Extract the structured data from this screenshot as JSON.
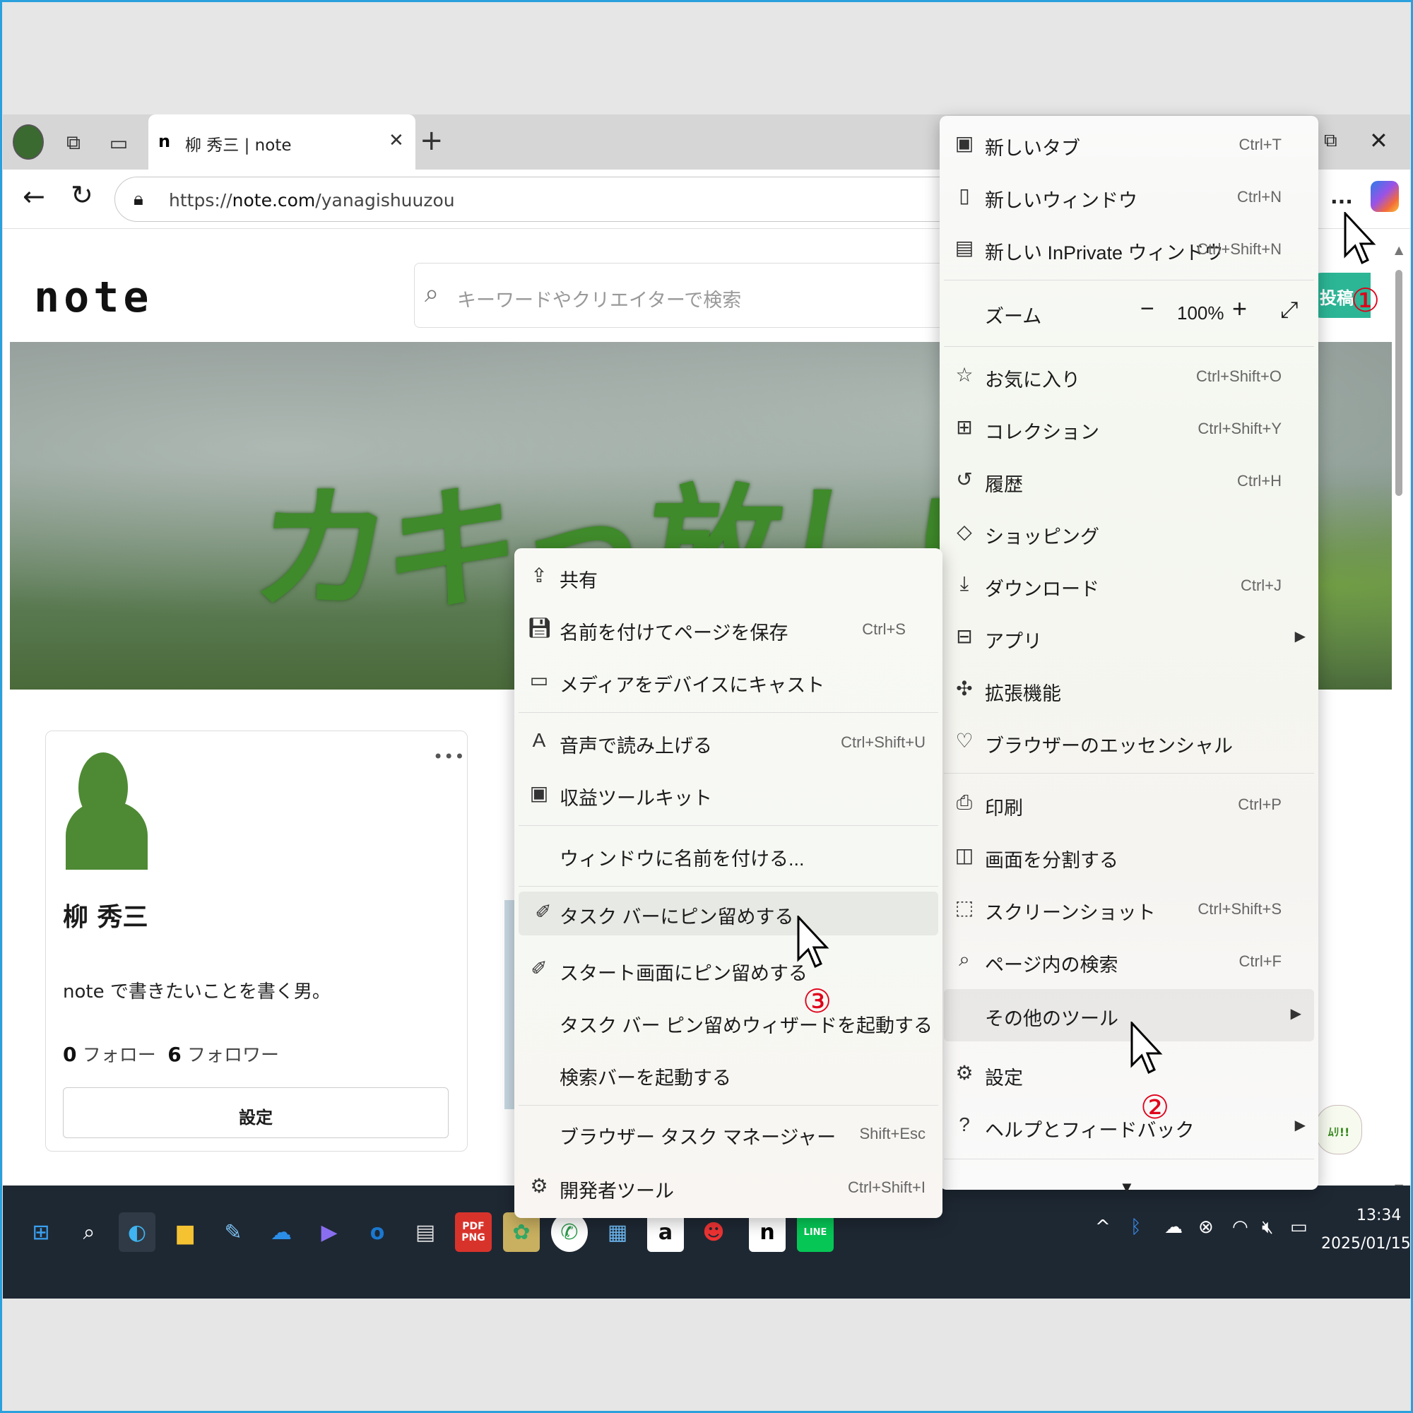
{
  "browser": {
    "tab_title": "柳 秀三 | note",
    "tab_favicon": "n",
    "url_prefix": "https://",
    "url_domain": "note.com",
    "url_path": "/yanagishuuzou",
    "more_label": "...",
    "icons": {
      "back": "back-arrow-icon",
      "refresh": "refresh-icon",
      "lock": "lock-icon",
      "copilot": "copilot-icon"
    }
  },
  "page": {
    "logo": "note",
    "search_placeholder": "キーワードやクリエイターで検索",
    "post_button": "投稿",
    "hero_text": "カキっ放し!!",
    "card_more": "•••",
    "user_name": "柳 秀三",
    "bio": "note で書きたいことを書く男。",
    "follow_count": "0",
    "follow_label": "フォロー",
    "follower_count": "6",
    "follower_label": "フォロワー",
    "settings_button": "設定",
    "stamp_text": "ﾑﾘ!!"
  },
  "main_menu": {
    "items": [
      {
        "label": "新しいタブ",
        "shortcut": "Ctrl+T"
      },
      {
        "label": "新しいウィンドウ",
        "shortcut": "Ctrl+N"
      },
      {
        "label": "新しい InPrivate ウィンドウ",
        "shortcut": "Ctrl+Shift+N"
      },
      {
        "label": "お気に入り",
        "shortcut": "Ctrl+Shift+O"
      },
      {
        "label": "コレクション",
        "shortcut": "Ctrl+Shift+Y"
      },
      {
        "label": "履歴",
        "shortcut": "Ctrl+H"
      },
      {
        "label": "ショッピング",
        "shortcut": ""
      },
      {
        "label": "ダウンロード",
        "shortcut": "Ctrl+J"
      },
      {
        "label": "アプリ",
        "shortcut": ""
      },
      {
        "label": "拡張機能",
        "shortcut": ""
      },
      {
        "label": "ブラウザーのエッセンシャル",
        "shortcut": ""
      },
      {
        "label": "印刷",
        "shortcut": "Ctrl+P"
      },
      {
        "label": "画面を分割する",
        "shortcut": ""
      },
      {
        "label": "スクリーンショット",
        "shortcut": "Ctrl+Shift+S"
      },
      {
        "label": "ページ内の検索",
        "shortcut": "Ctrl+F"
      },
      {
        "label": "その他のツール",
        "shortcut": ""
      },
      {
        "label": "設定",
        "shortcut": ""
      },
      {
        "label": "ヘルプとフィードバック",
        "shortcut": ""
      }
    ],
    "zoom_label": "ズーム",
    "zoom_value": "100%",
    "zoom_minus": "−",
    "zoom_plus": "+"
  },
  "more_tools_menu": {
    "items": [
      {
        "label": "共有",
        "shortcut": ""
      },
      {
        "label": "名前を付けてページを保存",
        "shortcut": "Ctrl+S"
      },
      {
        "label": "メディアをデバイスにキャスト",
        "shortcut": ""
      },
      {
        "label": "音声で読み上げる",
        "shortcut": "Ctrl+Shift+U"
      },
      {
        "label": "収益ツールキット",
        "shortcut": ""
      },
      {
        "label": "ウィンドウに名前を付ける...",
        "shortcut": ""
      },
      {
        "label": "タスク バーにピン留めする",
        "shortcut": ""
      },
      {
        "label": "スタート画面にピン留めする",
        "shortcut": ""
      },
      {
        "label": "タスク バー ピン留めウィザードを起動する",
        "shortcut": ""
      },
      {
        "label": "検索バーを起動する",
        "shortcut": ""
      },
      {
        "label": "ブラウザー タスク マネージャー",
        "shortcut": "Shift+Esc"
      },
      {
        "label": "開発者ツール",
        "shortcut": "Ctrl+Shift+I"
      }
    ]
  },
  "annotations": {
    "step1": "①",
    "step2": "②",
    "step3": "③"
  },
  "taskbar": {
    "pdf_label": "PDF PNG",
    "amazon_label": "a",
    "note_label": "n",
    "line_label": "LINE",
    "outlook_label": "o",
    "time": "13:34",
    "date": "2025/01/15"
  },
  "colors": {
    "accent": "#2cb696",
    "marker": "#e0001a",
    "taskbar": "#1e2833"
  }
}
